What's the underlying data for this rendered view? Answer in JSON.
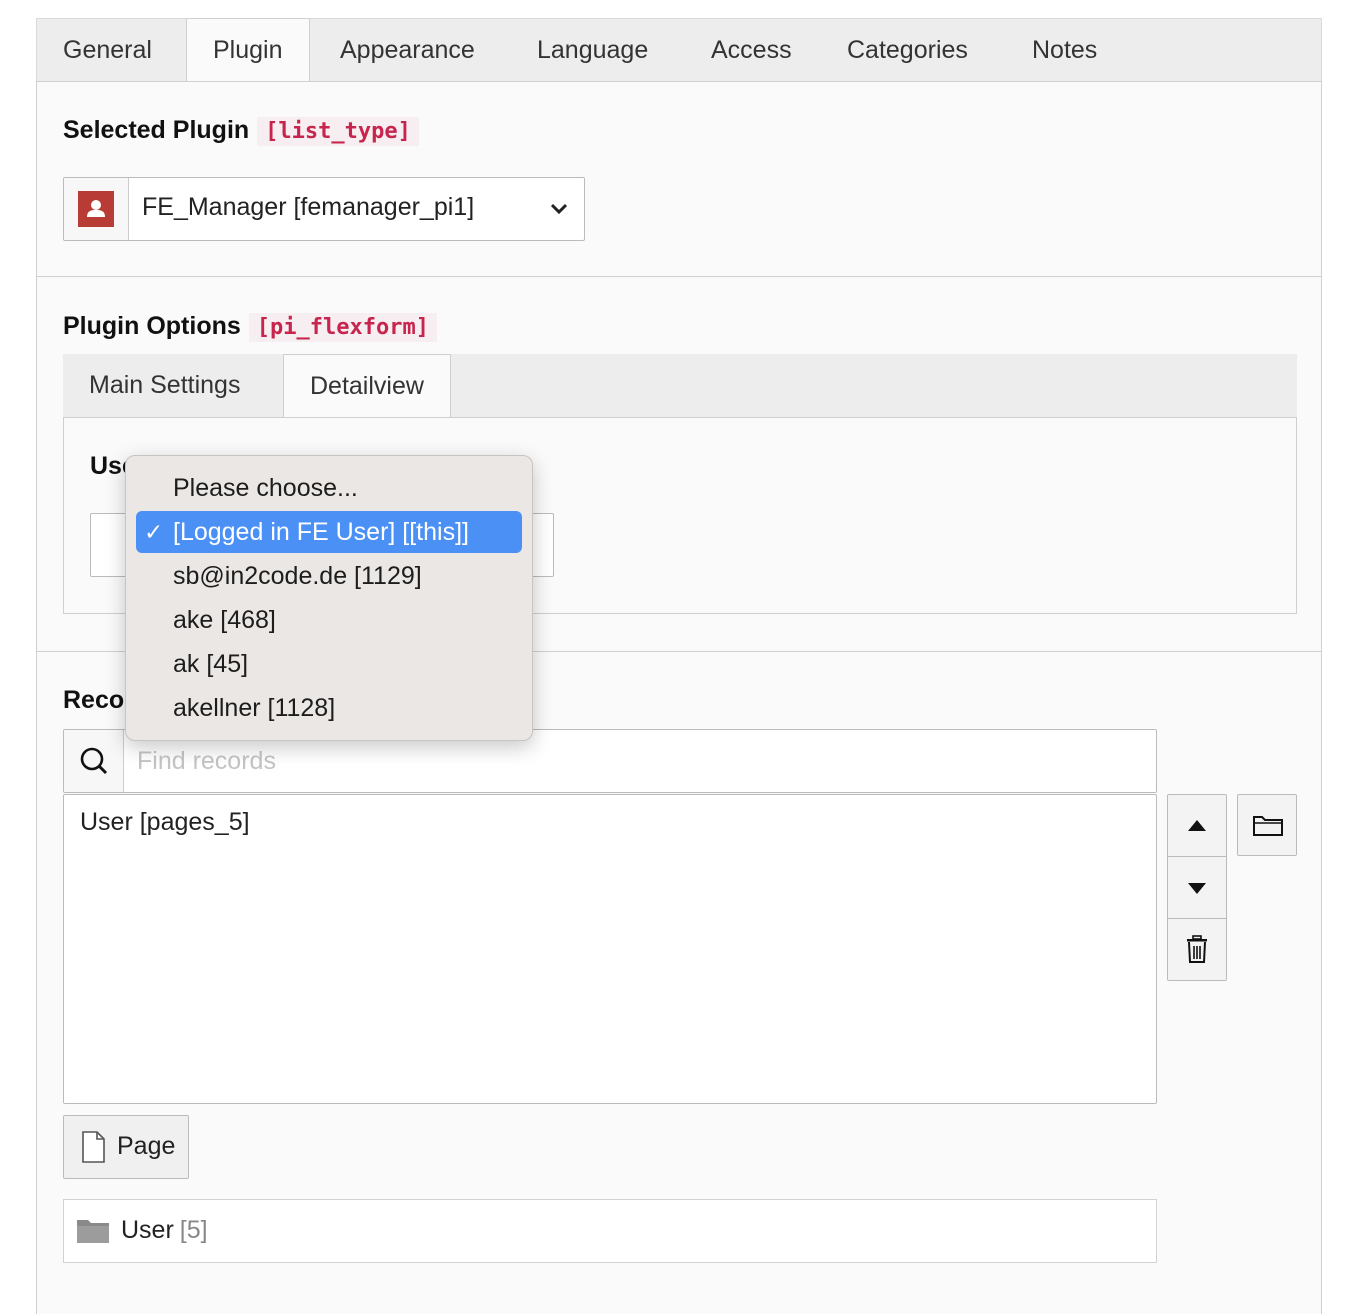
{
  "tabs": [
    {
      "label": "General",
      "active": false
    },
    {
      "label": "Plugin",
      "active": true
    },
    {
      "label": "Appearance",
      "active": false
    },
    {
      "label": "Language",
      "active": false
    },
    {
      "label": "Access",
      "active": false
    },
    {
      "label": "Categories",
      "active": false
    },
    {
      "label": "Notes",
      "active": false
    }
  ],
  "selected_plugin": {
    "label": "Selected Plugin",
    "field": "[list_type]",
    "value": "FE_Manager [femanager_pi1]",
    "icon": "user-plugin-icon",
    "icon_color": "#b93b35"
  },
  "plugin_options": {
    "label": "Plugin Options",
    "field": "[pi_flexform]",
    "subtabs": [
      {
        "label": "Main Settings",
        "active": false
      },
      {
        "label": "Detailview",
        "active": true
      }
    ],
    "user_field_label": "Use"
  },
  "user_dropdown": {
    "options": [
      {
        "label": "Please choose...",
        "selected": false
      },
      {
        "label": "[Logged in FE User] [[this]]",
        "selected": true
      },
      {
        "label": "sb@in2code.de [1129]",
        "selected": false
      },
      {
        "label": "ake [468]",
        "selected": false
      },
      {
        "label": "ak [45]",
        "selected": false
      },
      {
        "label": "akellner [1128]",
        "selected": false
      }
    ],
    "check_glyph": "✓",
    "highlight_color": "#4a90f5"
  },
  "records": {
    "label": "Reco",
    "search_placeholder": "Find records",
    "items": [
      "User [pages_5]"
    ],
    "add_button_label": "Page",
    "tree_item": {
      "label": "User",
      "id": "[5]"
    }
  }
}
